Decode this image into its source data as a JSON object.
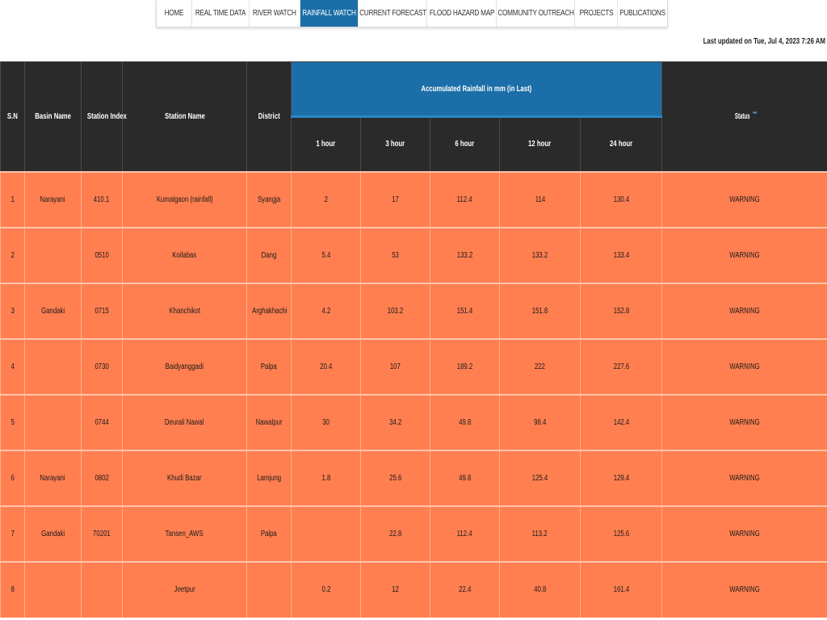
{
  "nav": {
    "items": [
      {
        "label": "HOME",
        "active": false
      },
      {
        "label": "REAL TIME DATA",
        "active": false
      },
      {
        "label": "RIVER WATCH",
        "active": false
      },
      {
        "label": "RAINFALL WATCH",
        "active": true
      },
      {
        "label": "CURRENT FORECAST",
        "active": false
      },
      {
        "label": "FLOOD HAZARD MAP",
        "active": false
      },
      {
        "label": "COMMUNITY OUTREACH",
        "active": false
      },
      {
        "label": "PROJECTS",
        "active": false
      },
      {
        "label": "PUBLICATIONS",
        "active": false
      }
    ]
  },
  "last_updated": "Last updated on Tue, Jul 4, 2023 7:26 AM",
  "table": {
    "headers": {
      "sn": "S.N",
      "basin": "Basin Name",
      "station_index": "Station Index",
      "station_name": "Station Name",
      "district": "District",
      "accumulated": "Accumulated Rainfall in mm (in Last)",
      "h1": "1 hour",
      "h3": "3 hour",
      "h6": "6 hour",
      "h12": "12 hour",
      "h24": "24 hour",
      "status": "Status",
      "status_marker": "***"
    },
    "rows": [
      {
        "sn": "1",
        "basin": "Narayani",
        "index": "410.1",
        "name": "Kumalgaon (rainfall)",
        "district": "Syangja",
        "h1": "2",
        "h3": "17",
        "h6": "112.4",
        "h12": "114",
        "h24": "130.4",
        "status": "WARNING"
      },
      {
        "sn": "2",
        "basin": "",
        "index": "0510",
        "name": "Koilabas",
        "district": "Dang",
        "h1": "5.4",
        "h3": "53",
        "h6": "133.2",
        "h12": "133.2",
        "h24": "133.4",
        "status": "WARNING"
      },
      {
        "sn": "3",
        "basin": "Gandaki",
        "index": "0715",
        "name": "Khanchikot",
        "district": "Arghakhachi",
        "h1": "4.2",
        "h3": "103.2",
        "h6": "151.4",
        "h12": "151.8",
        "h24": "152.8",
        "status": "WARNING"
      },
      {
        "sn": "4",
        "basin": "",
        "index": "0730",
        "name": "Baidyanggadi",
        "district": "Palpa",
        "h1": "20.4",
        "h3": "107",
        "h6": "189.2",
        "h12": "222",
        "h24": "227.6",
        "status": "WARNING"
      },
      {
        "sn": "5",
        "basin": "",
        "index": "0744",
        "name": "Deurali Nawal",
        "district": "Nawalpur",
        "h1": "30",
        "h3": "34.2",
        "h6": "49.8",
        "h12": "98.4",
        "h24": "142.4",
        "status": "WARNING"
      },
      {
        "sn": "6",
        "basin": "Narayani",
        "index": "0802",
        "name": "Khudi Bazar",
        "district": "Lamjung",
        "h1": "1.8",
        "h3": "25.6",
        "h6": "49.8",
        "h12": "125.4",
        "h24": "129.4",
        "status": "WARNING"
      },
      {
        "sn": "7",
        "basin": "Gandaki",
        "index": "70201",
        "name": "Tansen_AWS",
        "district": "Palpa",
        "h1": "",
        "h3": "22.8",
        "h6": "112.4",
        "h12": "113.2",
        "h24": "125.6",
        "status": "WARNING"
      },
      {
        "sn": "8",
        "basin": "",
        "index": "",
        "name": "Jeetpur",
        "district": "",
        "h1": "0.2",
        "h3": "12",
        "h6": "22.4",
        "h12": "40.8",
        "h24": "161.4",
        "status": "WARNING"
      }
    ]
  },
  "colors": {
    "header_bg": "#2a2a2a",
    "accent_blue": "#1b6ea8",
    "warning_row": "#ff7f50"
  }
}
